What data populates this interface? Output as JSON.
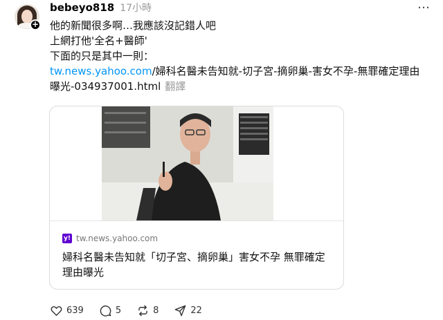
{
  "post": {
    "username": "bebeyo818",
    "timestamp": "17小時",
    "more_label": "…",
    "lines": [
      "他的新聞很多啊…我應該沒記錯人吧",
      "上網打他'全名+醫師'",
      "下面的只是其中一則："
    ],
    "link_domain": "tw.news.yahoo.com",
    "link_path_1": "/婦科名醫未告知就-切子宮-摘卵巢-害女不孕-無罪確定理由",
    "link_path_2": "曝光-034937001.html",
    "translate_label": "翻譯"
  },
  "card": {
    "source_icon_letter": "y!",
    "source": "tw.news.yahoo.com",
    "title": "婦科名醫未告知就「切子宮、摘卵巢」害女不孕 無罪確定理由曝光"
  },
  "actions": {
    "likes": "639",
    "comments": "5",
    "reposts": "8",
    "shares": "22"
  },
  "icons": {
    "avatar": "user-avatar",
    "follow": "plus-icon",
    "like": "heart-icon",
    "comment": "comment-icon",
    "repost": "repost-icon",
    "share": "send-icon",
    "source": "yahoo-logo-icon"
  },
  "colors": {
    "link": "#0095f6",
    "muted": "#999999",
    "yahoo": "#6001d2"
  }
}
